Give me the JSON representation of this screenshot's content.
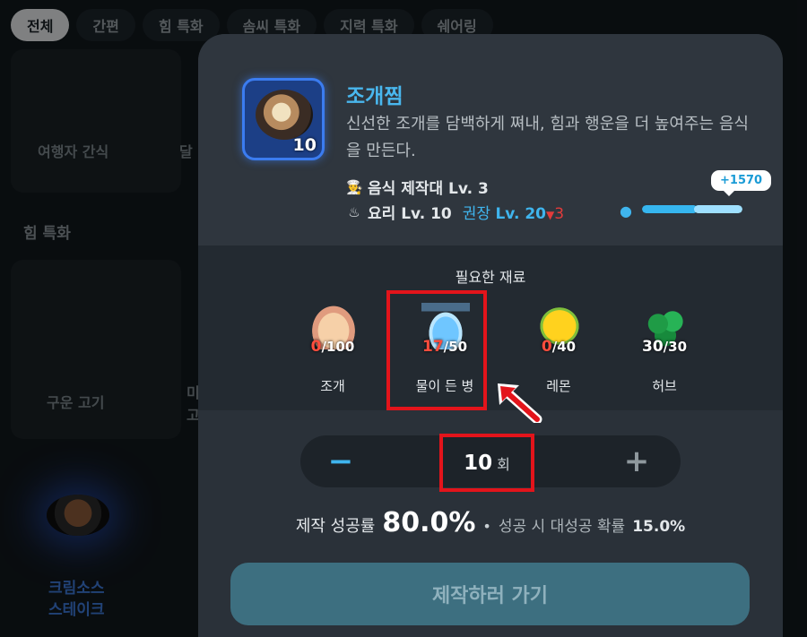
{
  "tabs": [
    "전체",
    "간편",
    "힘 특화",
    "솜씨 특화",
    "지력 특화",
    "쉐어링"
  ],
  "background": {
    "item1": "여행자 간식",
    "item2": "달",
    "section": "힘 특화",
    "item3": "구운 고기",
    "item4a": "미",
    "item4b": "고",
    "item5a": "크림소스",
    "item5b": "스테이크"
  },
  "recipe": {
    "name": "조개찜",
    "description": "신선한 조개를 담백하게 쪄내, 힘과 행운을 더 높여주는 음식을 만든다.",
    "thumb_count": "10",
    "station": "음식 제작대 Lv. 3",
    "skill": "요리 Lv. 10",
    "recommend_label": "권장",
    "recommend_level": "Lv. 20",
    "level_gap": "3",
    "level_gap_arrow": "▼",
    "xp_gain": "+1570",
    "xp_progress": 0.55,
    "xp_gain_progress": 0.45
  },
  "materials": {
    "title": "필요한 재료",
    "items": [
      {
        "name": "조개",
        "have": "0",
        "need": "/100",
        "icon": "shell-icon"
      },
      {
        "name": "물이 든 병",
        "have": "17",
        "need": "/50",
        "icon": "water-bottle-icon"
      },
      {
        "name": "레몬",
        "have": "0",
        "need": "/40",
        "icon": "lemon-icon"
      },
      {
        "name": "허브",
        "have": "30",
        "need": "/30",
        "icon": "herb-icon"
      }
    ]
  },
  "stepper": {
    "minus": "−",
    "plus": "+",
    "value": "10",
    "unit": "회"
  },
  "rates": {
    "success_label": "제작 성공률",
    "success_value": "80.0%",
    "separator": "•",
    "great_label": "성공 시 대성공 확률",
    "great_value": "15.0%"
  },
  "craft_button": "제작하러 가기",
  "colors": {
    "accent": "#49b7ee",
    "highlight": "#e3141b",
    "panel": "#2a3139"
  }
}
